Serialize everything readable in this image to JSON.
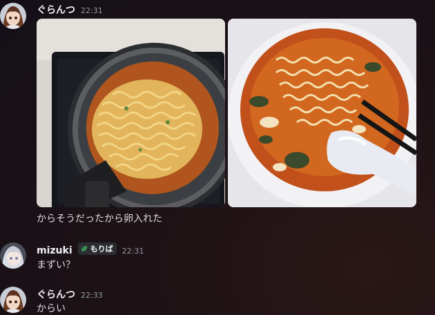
{
  "messages": [
    {
      "user": "ぐらんつ",
      "time": "22:31",
      "attachments": [
        "noodle-pot-photo",
        "noodle-bowl-photo"
      ],
      "text": "からそうだったから卵入れた"
    },
    {
      "user": "mizuki",
      "time": "22:31",
      "badge": "もりば",
      "text": "まずい？"
    },
    {
      "user": "ぐらんつ",
      "time": "22:33",
      "text": "からい"
    }
  ],
  "colors": {
    "background": "#1d1216",
    "username": "#f2f3f5",
    "timestamp": "#949ba4",
    "message_text": "#dbdee1",
    "badge_bg": "#2b2d31",
    "badge_leaf": "#3ba55d"
  },
  "icons": [
    "leaf-icon"
  ]
}
